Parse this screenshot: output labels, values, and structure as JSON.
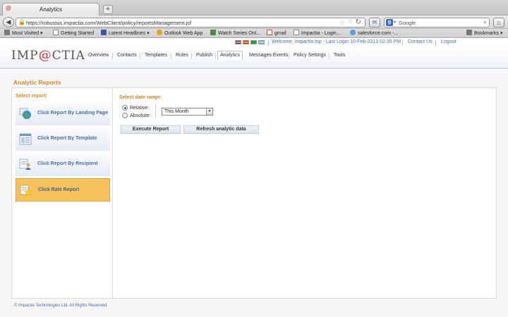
{
  "browser": {
    "tab_title": "Analytics",
    "new_tab_symbol": "+",
    "url": "https://robustus.impactia.com/WebClient/policy/reportsManagement.jsf",
    "search_placeholder": "Google",
    "bookmarks": [
      {
        "label": "Most Visited ▾",
        "color": "#7a7a7a"
      },
      {
        "label": "Getting Started",
        "color": "#e07b39"
      },
      {
        "label": "Latest Headlines ▾",
        "color": "#f09a2f"
      },
      {
        "label": "Outlook Web App",
        "color": "#e6a12a"
      },
      {
        "label": "Watch Series Onl...",
        "color": "#4e8a3e"
      },
      {
        "label": "gmail",
        "color": "#d44638"
      },
      {
        "label": "Impactia - Login...",
        "color": "#999999"
      },
      {
        "label": "salesforce.com -...",
        "color": "#4aa3df"
      }
    ],
    "bookmarks_menu": "Bookmarks ▾"
  },
  "site": {
    "logo_left": "IMP",
    "logo_at": "@",
    "logo_right": "CTIA",
    "welcome": "Welcome, impactia.top - Last Login  10-Feb-2013 02:35 PM",
    "contact_us": "Contact Us",
    "logout": "Logout",
    "nav": [
      {
        "label": "Overview",
        "active": false
      },
      {
        "label": "Contacts",
        "active": false
      },
      {
        "label": "Templates",
        "active": false
      },
      {
        "label": "Rules",
        "active": false
      },
      {
        "label": "Publish",
        "active": false
      },
      {
        "label": "Analytics",
        "active": true
      },
      {
        "label": "Messages Events",
        "active": false
      },
      {
        "label": "Policy Settings",
        "active": false
      },
      {
        "label": "Tools",
        "active": false
      }
    ],
    "accent_color": "#d1892a",
    "link_color": "#4a6da8"
  },
  "page": {
    "title": "Analytic Reports",
    "select_report_label": "Select report:",
    "reports": [
      {
        "label": "Click Report By Landing Page",
        "icon": "globe-icon",
        "active": false
      },
      {
        "label": "Click Report By Template",
        "icon": "template-icon",
        "active": false
      },
      {
        "label": "Click Report By Recipient",
        "icon": "recipient-icon",
        "active": false
      },
      {
        "label": "Click Rate Report",
        "icon": "star-report-icon",
        "active": true
      }
    ],
    "date_range_label": "Select date range:",
    "relative_label": "Relative:",
    "absolute_label": "Absolute:",
    "relative_selected": true,
    "range_value": "This Month",
    "execute_button": "Execute Report",
    "refresh_button": "Refresh analytic data"
  },
  "footer": {
    "copyright": "© Impactia Technologies Ltd. All Rights Reserved."
  }
}
